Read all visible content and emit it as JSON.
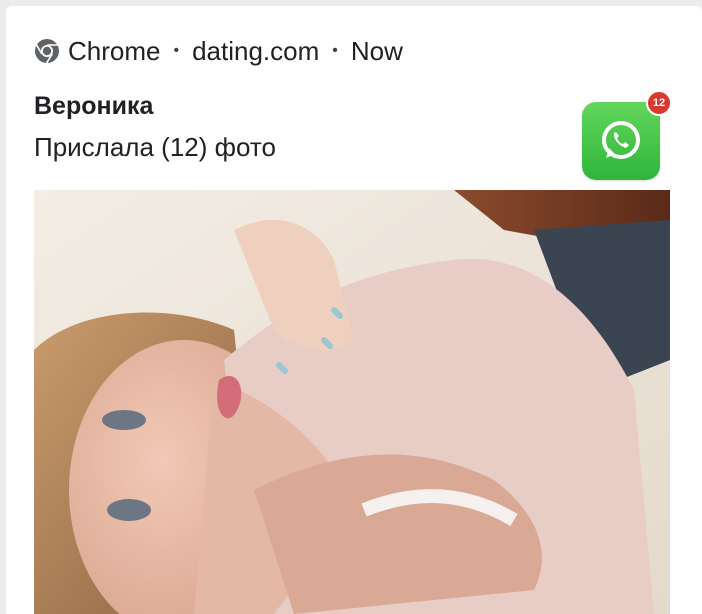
{
  "notification": {
    "app_name": "Chrome",
    "source": "dating.com",
    "time": "Now",
    "separator": "•",
    "sender": "Вероника",
    "message": "Прислала (12) фото",
    "badge_count": "12",
    "app_icon": "whatsapp-icon",
    "browser_icon": "chrome-icon",
    "accent_color": "#2fb53a",
    "badge_color": "#d93a2f"
  },
  "image": {
    "description_icon": "selfie-photo"
  }
}
